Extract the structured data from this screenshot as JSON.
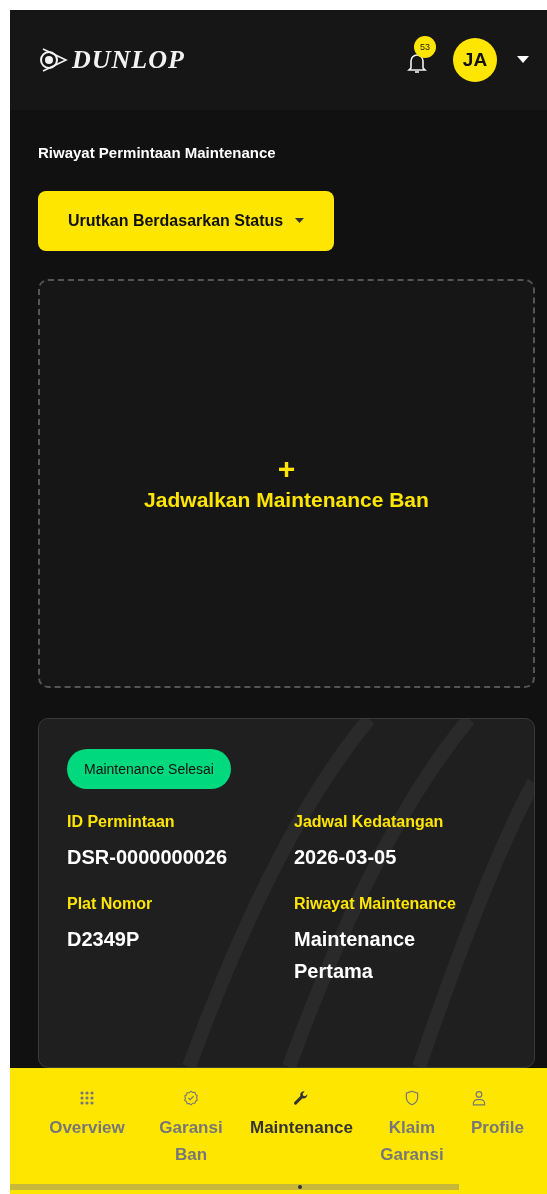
{
  "header": {
    "logo": "DUNLOP",
    "notification_count": "53",
    "avatar_initials": "JA"
  },
  "page_title": "Riwayat Permintaan Maintenance",
  "sort_button": {
    "label": "Urutkan Berdasarkan Status"
  },
  "schedule_card": {
    "icon": "+",
    "label": "Jadwalkan Maintenance Ban"
  },
  "requests": [
    {
      "status": "Maintenance Selesai",
      "color": "#00d97e",
      "fields": [
        {
          "label": "ID Permintaan",
          "value": "DSR-0000000026"
        },
        {
          "label": "Jadwal Kedatangan",
          "value": "2026-03-05"
        },
        {
          "label": "Plat Nomor",
          "value": "D2349P"
        },
        {
          "label": "Riwayat Maintenance",
          "value": "Maintenance Pertama"
        }
      ]
    }
  ],
  "bottom_nav": [
    {
      "kind": "grid",
      "label": "Overview",
      "selected": false
    },
    {
      "kind": "badge",
      "label": "Garansi Ban",
      "selected": false
    },
    {
      "kind": "wrench",
      "label": "Maintenance",
      "selected": true
    },
    {
      "kind": "shield",
      "label": "Klaim Garansi",
      "selected": false
    },
    {
      "kind": "person",
      "label": "Profile",
      "selected": false
    }
  ]
}
